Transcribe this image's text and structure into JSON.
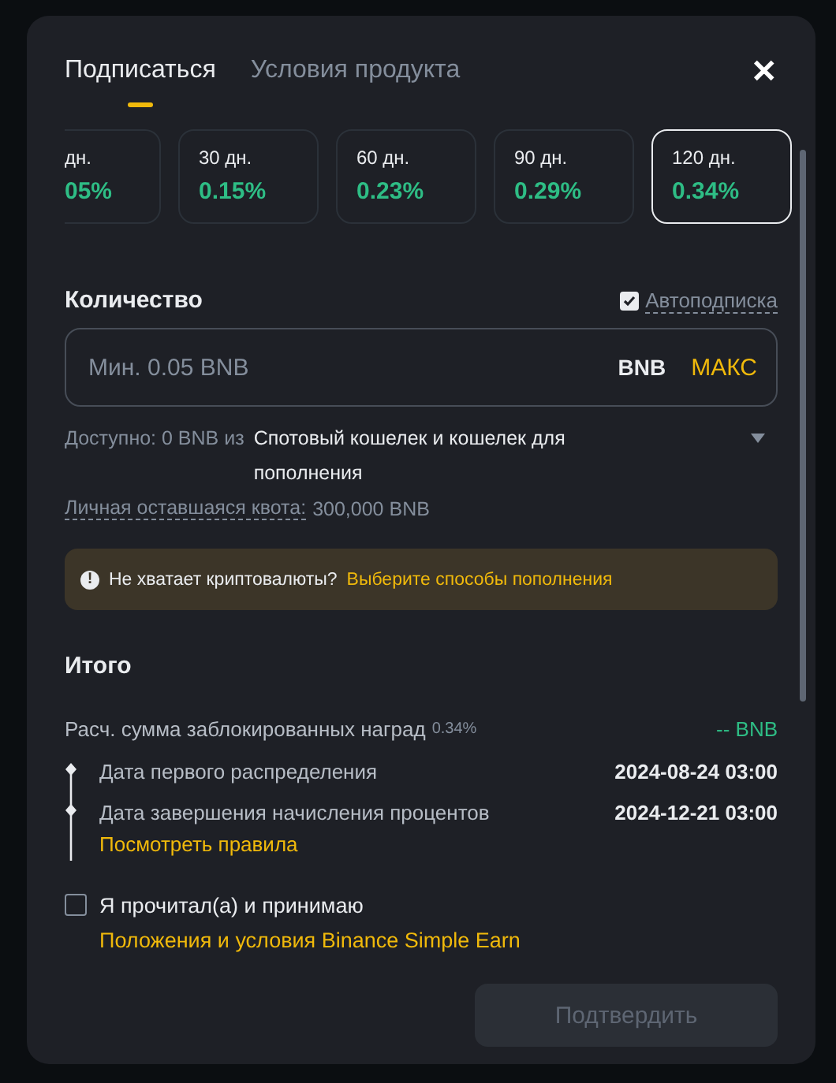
{
  "tabs": [
    {
      "label": "Подписаться",
      "selected": true
    },
    {
      "label": "Условия продукта",
      "selected": false
    }
  ],
  "close": "✕",
  "durations": [
    {
      "days": "дн.",
      "apr": "05%",
      "selected": false,
      "cut": true
    },
    {
      "days": "30 дн.",
      "apr": "0.15%",
      "selected": false,
      "cut": false
    },
    {
      "days": "60 дн.",
      "apr": "0.23%",
      "selected": false,
      "cut": false
    },
    {
      "days": "90 дн.",
      "apr": "0.29%",
      "selected": false,
      "cut": false
    },
    {
      "days": "120 дн.",
      "apr": "0.34%",
      "selected": true,
      "cut": false
    }
  ],
  "amount": {
    "title": "Количество",
    "auto_subscribe": {
      "label": "Автоподписка",
      "checked": true
    },
    "placeholder": "Мин. 0.05 BNB",
    "currency": "BNB",
    "max": "МАКС",
    "available_label": "Доступно: 0 BNB из",
    "wallet": "Спотовый кошелек и кошелек для пополнения",
    "quota_label": "Личная оставшаяся квота:",
    "quota_value": "300,000 BNB"
  },
  "alert": {
    "icon": "!",
    "text": "Не хватает криптовалюты?",
    "link": "Выберите способы пополнения"
  },
  "summary": {
    "title": "Итого",
    "rewards_label": "Расч. сумма заблокированных наград",
    "rewards_rate": "0.34%",
    "rewards_value": "-- BNB",
    "dates": [
      {
        "label": "Дата первого распределения",
        "value": "2024-08-24 03:00"
      },
      {
        "label": "Дата завершения начисления процентов",
        "value": "2024-12-21 03:00"
      }
    ],
    "rules_link": "Посмотреть правила"
  },
  "agreement": {
    "checked": false,
    "text": "Я прочитал(а) и принимаю",
    "link": "Положения и условия Binance Simple Earn"
  },
  "confirm": {
    "label": "Подтвердить",
    "disabled": true
  }
}
